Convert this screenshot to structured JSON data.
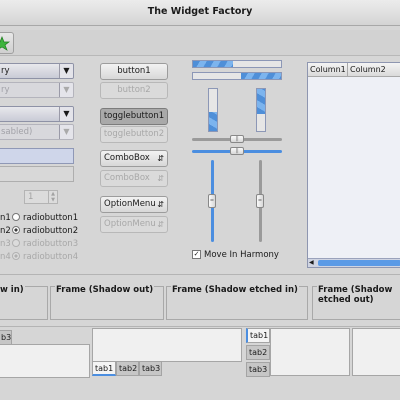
{
  "window": {
    "title": "The Widget Factory"
  },
  "left": {
    "combo1": "ry",
    "combo2": "ry",
    "combo3": "",
    "combo4": "sabled)",
    "spin_value": "1",
    "radio_col1": [
      "n1",
      "n2",
      "n3",
      "n4"
    ],
    "radios": [
      "radiobutton1",
      "radiobutton2",
      "radiobutton3",
      "radiobutton4"
    ]
  },
  "buttons": {
    "button1": "button1",
    "button2": "button2",
    "toggle1": "togglebutton1",
    "toggle2": "togglebutton2",
    "combobox": "ComboBox",
    "combobox_dis": "ComboBox",
    "optionmenu": "OptionMenu",
    "optionmenu_dis": "OptionMenu"
  },
  "progress": {
    "h1_fraction": 0.45,
    "h2_fraction": 0.45,
    "v1_fraction": 0.45,
    "v2_fraction": 0.6
  },
  "sliders": {
    "h1_value": 0.5,
    "h2_value": 0.5,
    "v1_value": 0.5,
    "v2_value": 0.5
  },
  "harmony": {
    "label": "Move In Harmony",
    "checked": true
  },
  "tree": {
    "columns": [
      "Column1",
      "Column2"
    ]
  },
  "frames": [
    {
      "label": "w in)"
    },
    {
      "label": "Frame (Shadow out)"
    },
    {
      "label": "Frame (Shadow etched in)"
    },
    {
      "label": "Frame (Shadow etched out)"
    }
  ],
  "notebooks": {
    "nb1_tabs": [
      "b3"
    ],
    "nb2_tabs": [
      "tab1",
      "tab2",
      "tab3"
    ],
    "nb3_tabs": [
      "tab1",
      "tab2",
      "tab3"
    ]
  },
  "colors": {
    "accent": "#4b8ee0",
    "toolbar_icon": "#3cb43c"
  },
  "icons": {
    "toolbar": "star-icon",
    "combo_arrow": "chevron-down-icon",
    "spin_arrows": "up-down-arrows-icon",
    "check": "checkmark-icon"
  }
}
